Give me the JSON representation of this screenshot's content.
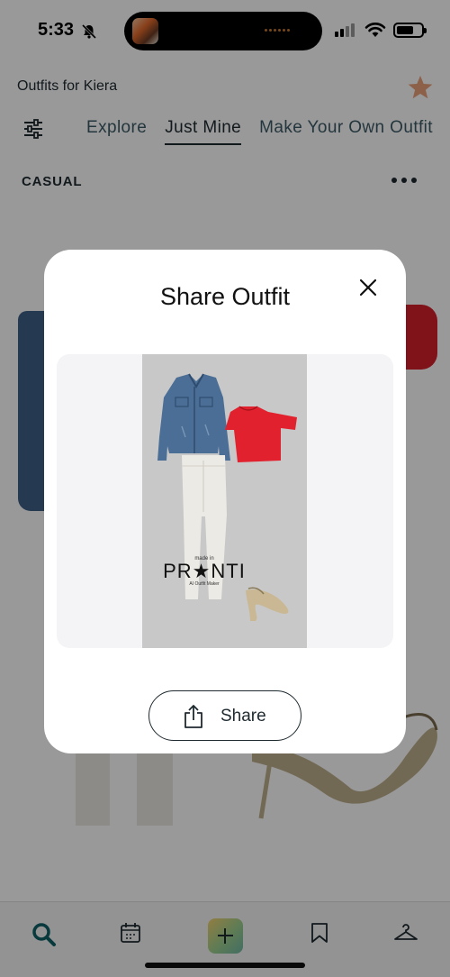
{
  "status_bar": {
    "time": "5:33"
  },
  "app": {
    "title": "Outfits for Kiera"
  },
  "tabs": [
    {
      "label": "Explore"
    },
    {
      "label": "Just Mine",
      "active": true
    },
    {
      "label": "Make Your Own Outfit"
    }
  ],
  "section": {
    "title": "CASUAL"
  },
  "modal": {
    "title": "Share Outfit",
    "watermark": {
      "small": "made in",
      "brand": "PR★NTI",
      "tagline": "AI Outfit Maker"
    },
    "share_label": "Share"
  },
  "bottom_nav": [
    "search-icon",
    "calendar-icon",
    "add-icon",
    "bookmark-icon",
    "hanger-icon"
  ],
  "colors": {
    "accent_star": "#e9a07a",
    "text_dark": "#1e2a30",
    "top_red": "#e1222e",
    "jacket_denim": "#4b6e96",
    "overlay": "rgba(0,0,0,0.40)"
  }
}
